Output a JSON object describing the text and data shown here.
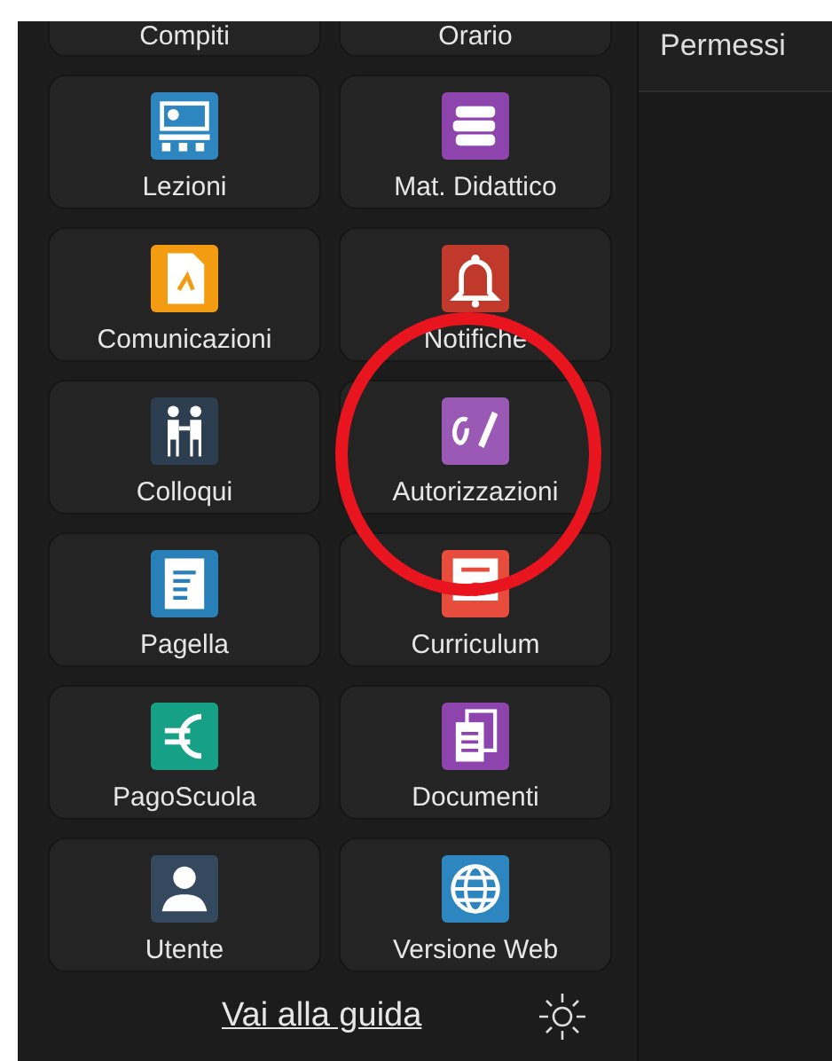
{
  "partial_tiles": [
    {
      "label": "Compiti"
    },
    {
      "label": "Orario"
    }
  ],
  "tiles": [
    {
      "label": "Lezioni",
      "kind": "lessons",
      "color": "#2e86c1",
      "highlighted": false
    },
    {
      "label": "Mat. Didattico",
      "kind": "books",
      "color": "#8e44ad",
      "highlighted": false
    },
    {
      "label": "Comunicazioni",
      "kind": "pdf",
      "color": "#f39c12",
      "highlighted": false
    },
    {
      "label": "Notifiche",
      "kind": "bell",
      "color": "#c0392b",
      "highlighted": false
    },
    {
      "label": "Colloqui",
      "kind": "people",
      "color": "#2c3e50",
      "highlighted": false
    },
    {
      "label": "Autorizzazioni",
      "kind": "signature",
      "color": "#9b59b6",
      "highlighted": true
    },
    {
      "label": "Pagella",
      "kind": "report",
      "color": "#2980b9",
      "highlighted": false
    },
    {
      "label": "Curriculum",
      "kind": "certificate",
      "color": "#e74c3c",
      "highlighted": false
    },
    {
      "label": "PagoScuola",
      "kind": "euro",
      "color": "#16a085",
      "highlighted": false
    },
    {
      "label": "Documenti",
      "kind": "documents",
      "color": "#8e44ad",
      "highlighted": false
    },
    {
      "label": "Utente",
      "kind": "user",
      "color": "#34495e",
      "highlighted": false
    },
    {
      "label": "Versione Web",
      "kind": "globe",
      "color": "#2e86c1",
      "highlighted": false
    }
  ],
  "footer": {
    "guide_link": "Vai alla guida"
  },
  "detail": {
    "title": "Permessi"
  }
}
